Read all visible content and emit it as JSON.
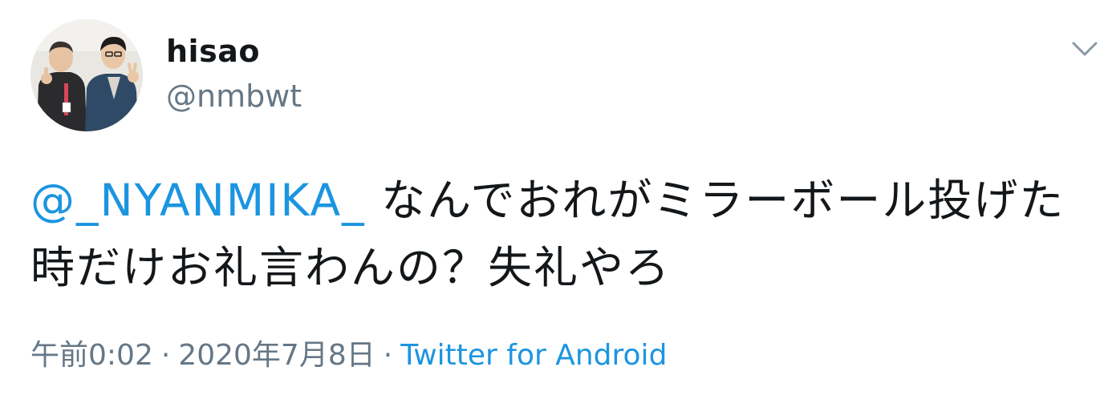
{
  "tweet": {
    "author": {
      "display_name": "hisao",
      "handle": "@nmbwt",
      "avatar_icon": "profile-photo-two-people-peace-sign"
    },
    "menu_icon": "chevron-down-icon",
    "text": {
      "mention": "@_NYANMIKA_",
      "body": " なんでおれがミラーボール投げた時だけお礼言わんの？失礼やろ"
    },
    "meta": {
      "time": "午前0:02",
      "separator_1": "·",
      "date": "2020年7月8日",
      "separator_2": "·",
      "source": "Twitter for Android"
    },
    "colors": {
      "link": "#1b95e0",
      "secondary": "#657786",
      "primary_text": "#14171a"
    }
  }
}
